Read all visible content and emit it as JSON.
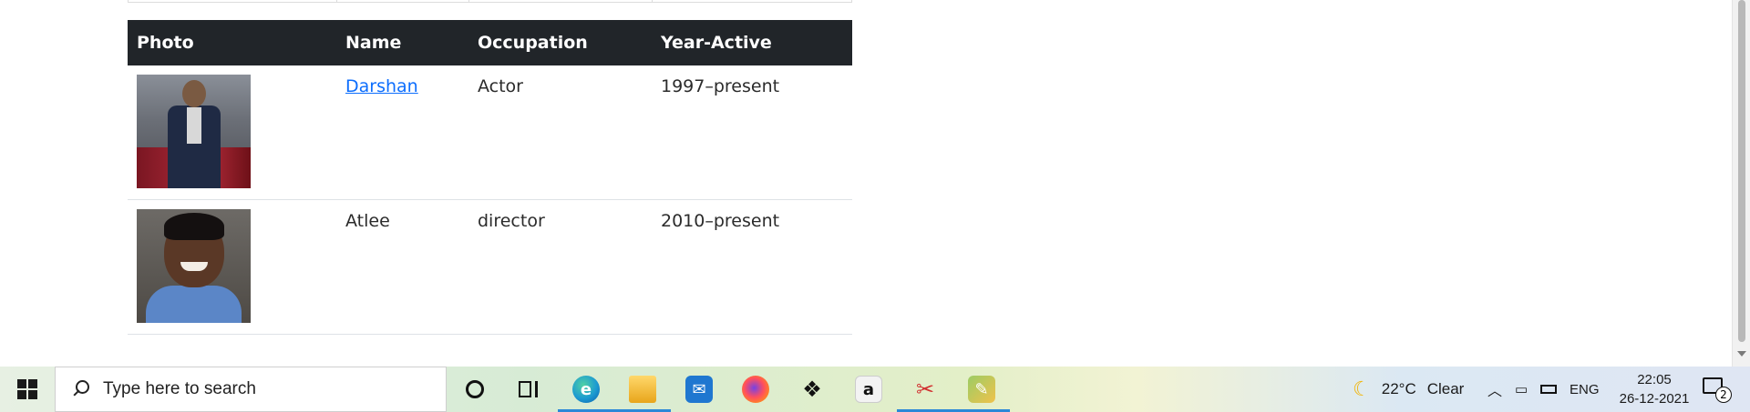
{
  "table": {
    "headers": {
      "photo": "Photo",
      "name": "Name",
      "occupation": "Occupation",
      "year_active": "Year-Active"
    },
    "rows": [
      {
        "name": "Darshan",
        "occupation": "Actor",
        "year_active": "1997–present"
      },
      {
        "name": "Atlee",
        "occupation": "director",
        "year_active": "2010–present"
      }
    ]
  },
  "taskbar": {
    "search_placeholder": "Type here to search",
    "weather": {
      "temp": "22°C",
      "condition": "Clear",
      "icon": "moon-icon"
    },
    "language": "ENG",
    "time": "22:05",
    "date": "26-12-2021",
    "notification_count": "2",
    "apps": [
      "cortana-icon",
      "task-view-icon",
      "edge-icon",
      "file-explorer-icon",
      "mail-icon",
      "firefox-icon",
      "dropbox-icon",
      "amazon-icon",
      "snip-tool-icon",
      "paint-icon"
    ]
  },
  "colors": {
    "header_bg": "#212529",
    "link": "#0d6efd",
    "taskbar_active": "#2b88d8"
  }
}
